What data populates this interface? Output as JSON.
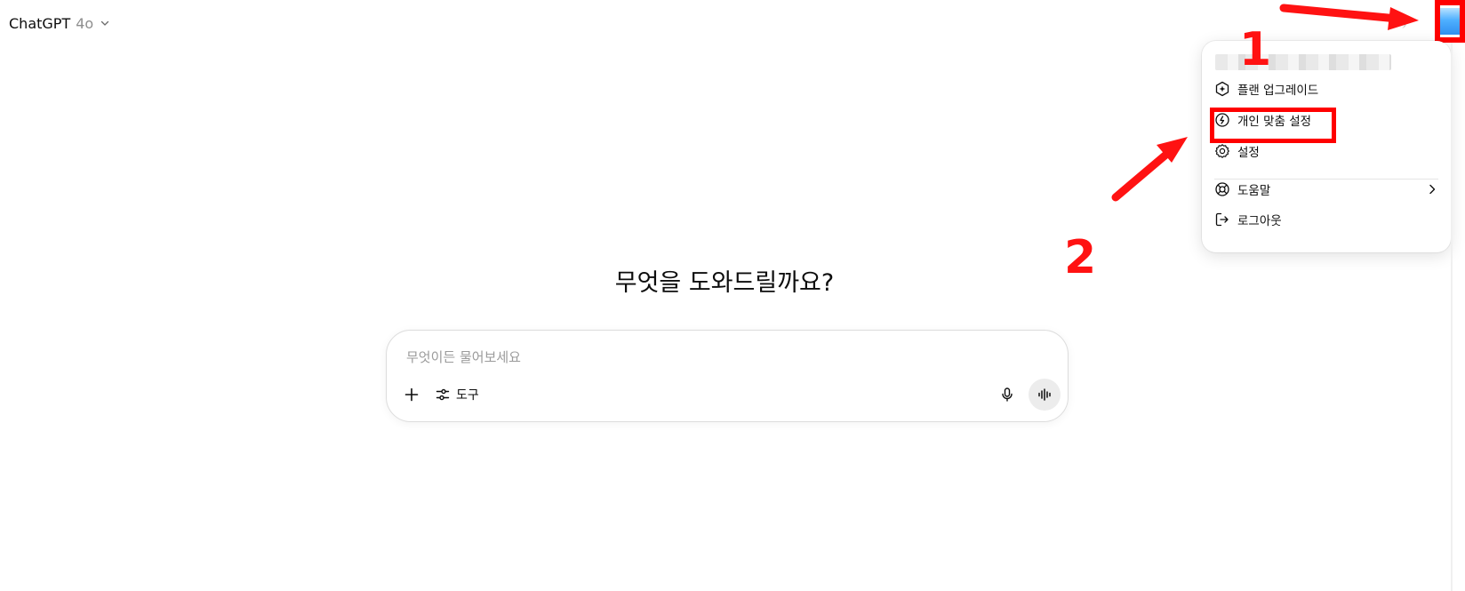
{
  "header": {
    "app_name": "ChatGPT",
    "model_version": "4o"
  },
  "menu": {
    "items": [
      {
        "label": "플랜 업그레이드",
        "icon": "upgrade-plan-icon"
      },
      {
        "label": "개인 맞춤 설정",
        "icon": "personalization-icon"
      },
      {
        "label": "설정",
        "icon": "gear-icon"
      },
      {
        "label": "도움말",
        "icon": "help-lifebuoy-icon"
      },
      {
        "label": "로그아웃",
        "icon": "logout-icon"
      }
    ]
  },
  "annotations": {
    "step1": "1",
    "step2": "2",
    "color": "#ff0000"
  },
  "main": {
    "headline": "무엇을 도와드릴까요?",
    "composer": {
      "placeholder": "무엇이든 물어보세요",
      "tools_label": "도구"
    }
  }
}
